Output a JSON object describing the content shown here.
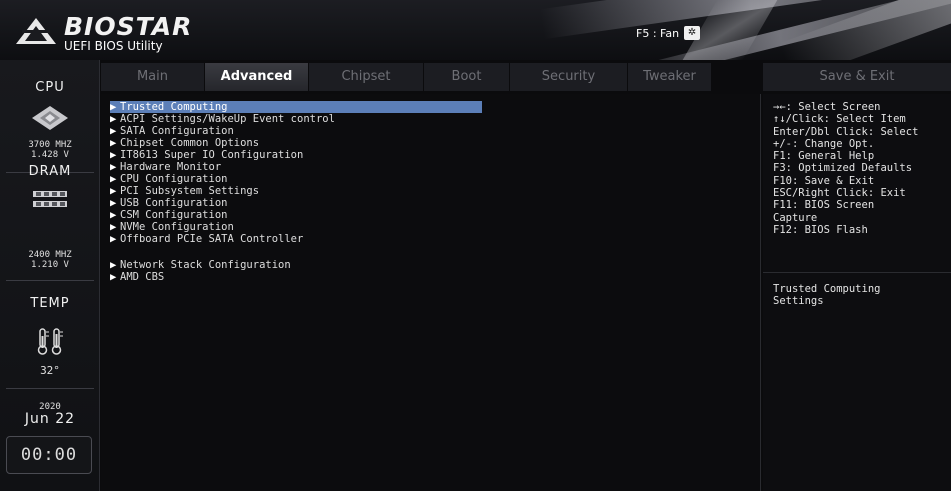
{
  "header": {
    "brand": "BIOSTAR",
    "subtitle": "UEFI BIOS Utility",
    "fan_label": "F5 : Fan",
    "fan_icon": "fan-icon"
  },
  "sidebar": {
    "cpu_label": "CPU",
    "cpu_freq": "3700 MHZ",
    "cpu_volt": "1.428 V",
    "dram_label": "DRAM",
    "dram_freq": "2400 MHZ",
    "dram_volt": "1.210 V",
    "temp_label": "TEMP",
    "temp_value": "32°",
    "year": "2020",
    "date": "Jun 22",
    "time": "00:00"
  },
  "tabs": [
    {
      "label": "Main"
    },
    {
      "label": "Advanced"
    },
    {
      "label": "Chipset"
    },
    {
      "label": "Boot"
    },
    {
      "label": "Security"
    },
    {
      "label": "Tweaker"
    }
  ],
  "save_exit_tab": "Save & Exit",
  "menu": [
    "Trusted Computing",
    "ACPI Settings/WakeUp Event control",
    "SATA Configuration",
    "Chipset Common Options",
    "IT8613 Super IO Configuration",
    "Hardware Monitor",
    "CPU Configuration",
    "PCI Subsystem Settings",
    "USB Configuration",
    "CSM Configuration",
    "NVMe Configuration",
    "Offboard PCIe SATA Controller",
    "Network Stack Configuration",
    "AMD CBS"
  ],
  "help": {
    "keys": [
      "→←: Select Screen",
      "↑↓/Click: Select Item",
      "Enter/Dbl Click: Select",
      "+/-: Change Opt.",
      "F1: General Help",
      "F3: Optimized Defaults",
      "F10: Save & Exit",
      "ESC/Right Click: Exit",
      "F11: BIOS Screen",
      "Capture",
      "F12: BIOS Flash"
    ],
    "description_line1": "Trusted Computing",
    "description_line2": "Settings"
  },
  "colors": {
    "selection": "#5c7fb8",
    "active_tab": "#3a3b41"
  }
}
